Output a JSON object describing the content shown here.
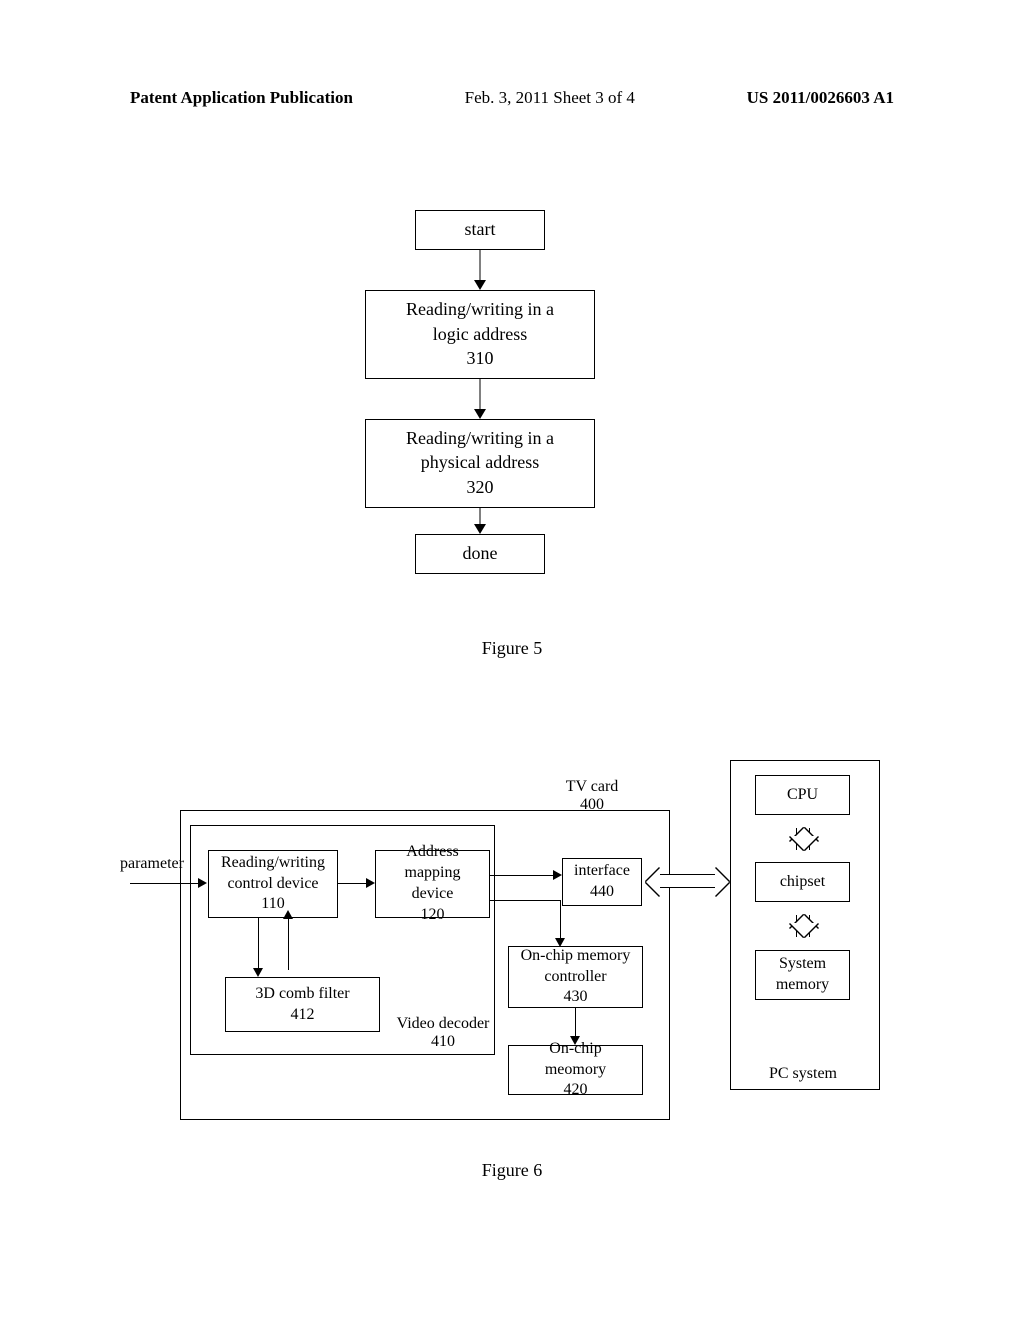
{
  "header": {
    "left": "Patent Application Publication",
    "mid": "Feb. 3, 2011  Sheet 3 of 4",
    "right": "US 2011/0026603 A1"
  },
  "fig5": {
    "start": "start",
    "step310_l1": "Reading/writing in a",
    "step310_l2": "logic address",
    "step310_num": "310",
    "step320_l1": "Reading/writing in a",
    "step320_l2": "physical address",
    "step320_num": "320",
    "done": "done",
    "caption": "Figure 5"
  },
  "fig6": {
    "param_label": "parameter",
    "box110_l1": "Reading/writing",
    "box110_l2": "control device",
    "box110_num": "110",
    "box120_l1": "Address",
    "box120_l2": "mapping device",
    "box120_num": "120",
    "box412_l1": "3D comb filter",
    "box412_num": "412",
    "box410_l1": "Video decoder",
    "box410_num": "410",
    "box440_l1": "interface",
    "box440_num": "440",
    "box430_l1": "On-chip memory",
    "box430_l2": "controller",
    "box430_num": "430",
    "box420_l1": "On-chip meomory",
    "box420_num": "420",
    "tvcard_l1": "TV card",
    "tvcard_num": "400",
    "cpu": "CPU",
    "chipset": "chipset",
    "sysmem_l1": "System",
    "sysmem_l2": "memory",
    "pcsys": "PC system",
    "caption": "Figure 6"
  }
}
